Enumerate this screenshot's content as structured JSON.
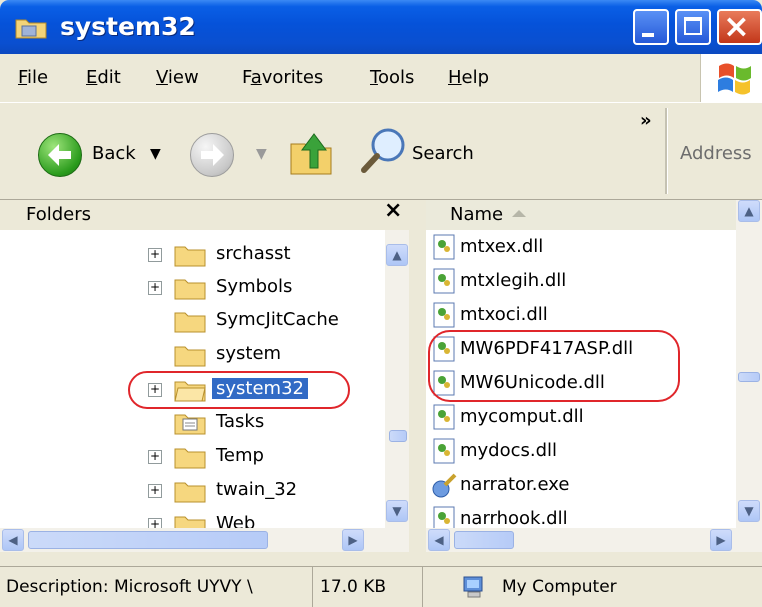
{
  "window": {
    "title": "system32",
    "icon": "folder-icon",
    "controls": [
      "minimize-icon",
      "maximize-icon",
      "close-icon"
    ]
  },
  "menu": {
    "items": [
      {
        "label": "File",
        "accel": "F",
        "rest": "ile"
      },
      {
        "label": "Edit",
        "accel": "E",
        "rest": "dit"
      },
      {
        "label": "View",
        "accel": "V",
        "rest": "iew"
      },
      {
        "label": "Favorites",
        "accel": "a",
        "pre": "F",
        "rest": "vorites"
      },
      {
        "label": "Tools",
        "accel": "T",
        "rest": "ools"
      },
      {
        "label": "Help",
        "accel": "H",
        "rest": "elp"
      }
    ]
  },
  "toolbar": {
    "back_label": "Back",
    "search_label": "Search",
    "address_label": "Address",
    "overflow_glyph": "»"
  },
  "folders_pane": {
    "title": "Folders",
    "close_glyph": "×",
    "items": [
      {
        "label": "srchasst",
        "expandable": true,
        "selected": false,
        "icon": "folder-icon"
      },
      {
        "label": "Symbols",
        "expandable": true,
        "selected": false,
        "icon": "folder-icon"
      },
      {
        "label": "SymcJitCache",
        "expandable": false,
        "selected": false,
        "icon": "folder-icon"
      },
      {
        "label": "system",
        "expandable": false,
        "selected": false,
        "icon": "folder-icon"
      },
      {
        "label": "system32",
        "expandable": true,
        "selected": true,
        "icon": "folder-open-icon"
      },
      {
        "label": "Tasks",
        "expandable": false,
        "selected": false,
        "icon": "tasks-folder-icon"
      },
      {
        "label": "Temp",
        "expandable": true,
        "selected": false,
        "icon": "folder-icon"
      },
      {
        "label": "twain_32",
        "expandable": true,
        "selected": false,
        "icon": "folder-icon"
      },
      {
        "label": "Web",
        "expandable": true,
        "selected": false,
        "icon": "folder-icon"
      }
    ]
  },
  "file_list": {
    "column_name": "Name",
    "sort": "ascending",
    "files": [
      {
        "name": "mtxex.dll",
        "icon": "dll-icon"
      },
      {
        "name": "mtxlegih.dll",
        "icon": "dll-icon"
      },
      {
        "name": "mtxoci.dll",
        "icon": "dll-icon"
      },
      {
        "name": "MW6PDF417ASP.dll",
        "icon": "dll-icon"
      },
      {
        "name": "MW6Unicode.dll",
        "icon": "dll-icon"
      },
      {
        "name": "mycomput.dll",
        "icon": "dll-icon"
      },
      {
        "name": "mydocs.dll",
        "icon": "dll-icon"
      },
      {
        "name": "narrator.exe",
        "icon": "exe-icon"
      },
      {
        "name": "narrhook.dll",
        "icon": "dll-icon"
      }
    ]
  },
  "status_bar": {
    "description": "Description: Microsoft UYVY \\",
    "size": "17.0 KB",
    "location": "My Computer"
  },
  "colors": {
    "title_bar": "#0552d9",
    "selection": "#316ac5",
    "highlight_circle": "#e0262b"
  }
}
